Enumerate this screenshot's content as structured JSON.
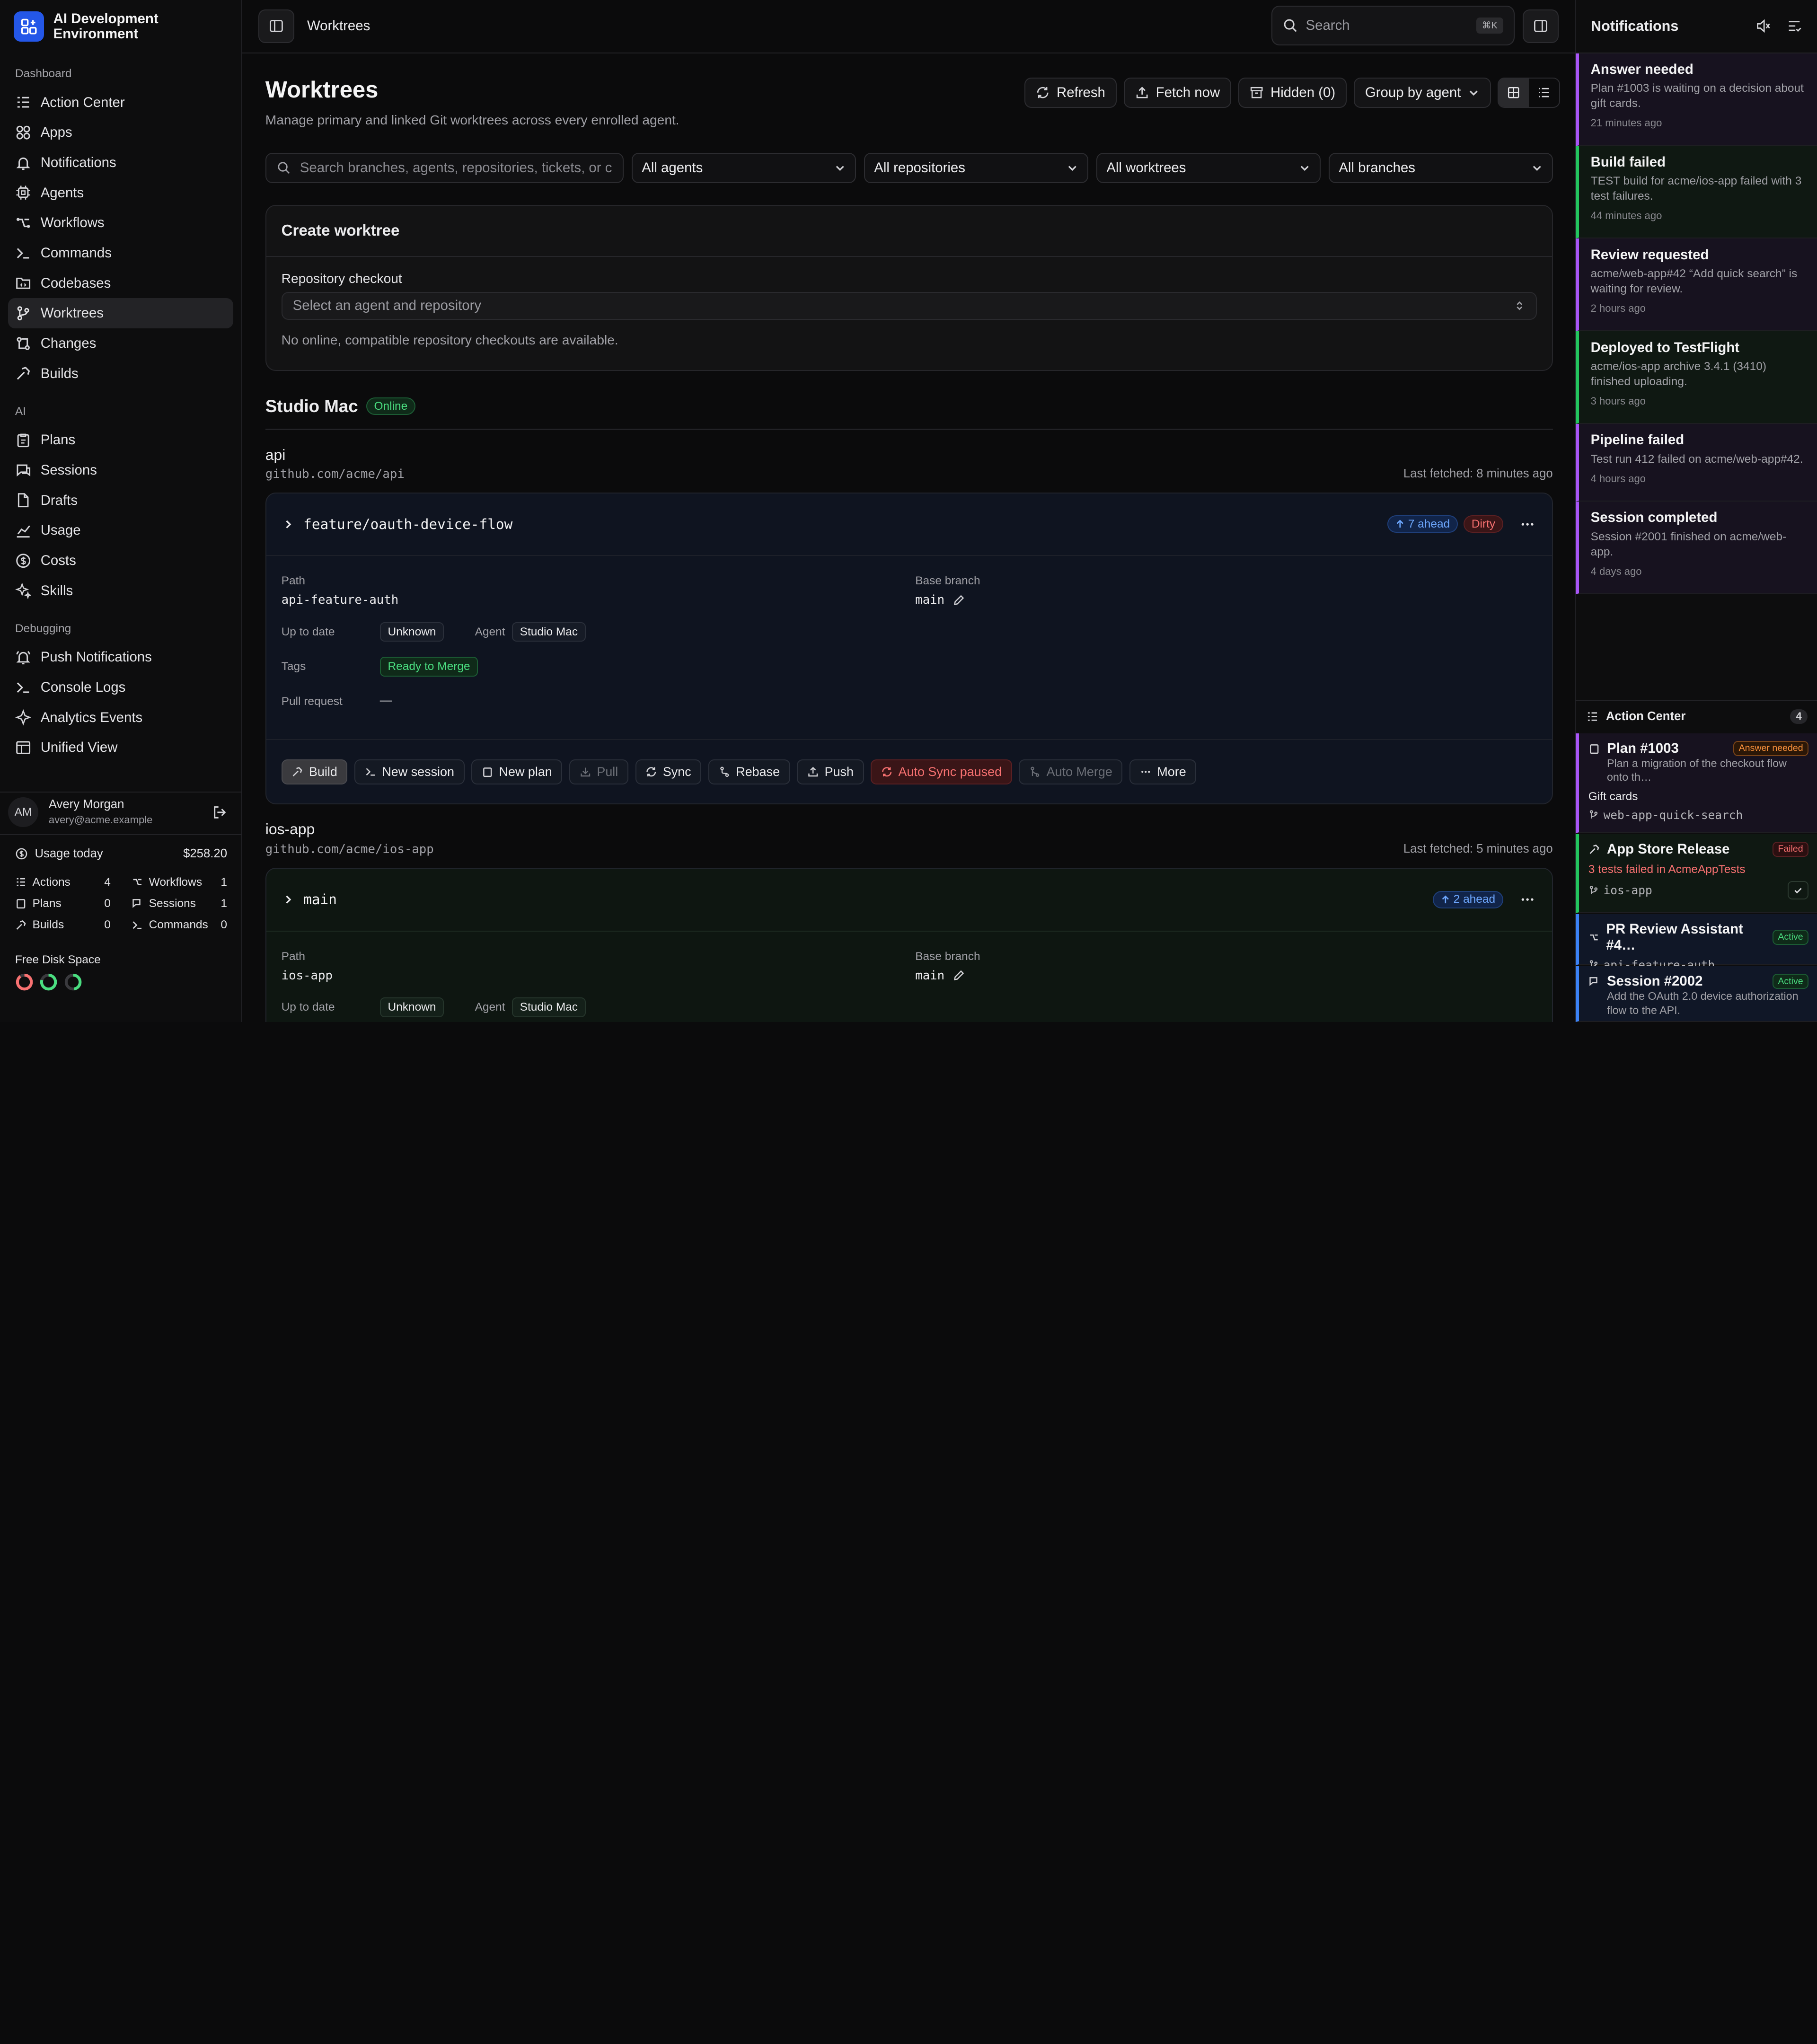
{
  "app": {
    "title_line1": "AI Development",
    "title_line2": "Environment"
  },
  "sidebar": {
    "sections": [
      {
        "label": "Dashboard",
        "items": [
          "Action Center",
          "Apps",
          "Notifications",
          "Agents",
          "Workflows",
          "Commands",
          "Codebases",
          "Worktrees",
          "Changes",
          "Builds"
        ]
      },
      {
        "label": "AI",
        "items": [
          "Plans",
          "Sessions",
          "Drafts",
          "Usage",
          "Costs",
          "Skills"
        ]
      },
      {
        "label": "Debugging",
        "items": [
          "Push Notifications",
          "Console Logs",
          "Analytics Events",
          "Unified View"
        ]
      }
    ],
    "active": "Worktrees",
    "user": {
      "initials": "AM",
      "name": "Avery Morgan",
      "email": "avery@acme.example"
    },
    "usage": {
      "label": "Usage today",
      "amount": "$258.20"
    },
    "stats": [
      {
        "label": "Actions",
        "value": "4"
      },
      {
        "label": "Workflows",
        "value": "1"
      },
      {
        "label": "Plans",
        "value": "0"
      },
      {
        "label": "Sessions",
        "value": "1"
      },
      {
        "label": "Builds",
        "value": "0"
      },
      {
        "label": "Commands",
        "value": "0"
      }
    ],
    "disk_label": "Free Disk Space",
    "disk_colors": [
      "#f87171",
      "#4ade80",
      "#4ade80"
    ]
  },
  "topbar": {
    "breadcrumb": "Worktrees",
    "search_placeholder": "Search",
    "search_shortcut": "⌘K"
  },
  "page": {
    "title": "Worktrees",
    "subtitle": "Manage primary and linked Git worktrees across every enrolled agent.",
    "toolbar": {
      "refresh": "Refresh",
      "fetch": "Fetch now",
      "hidden": "Hidden (0)",
      "group": "Group by agent"
    },
    "filters": {
      "search_placeholder": "Search branches, agents, repositories, tickets, or c",
      "agents": "All agents",
      "repos": "All repositories",
      "worktrees": "All worktrees",
      "branches": "All branches"
    },
    "create": {
      "title": "Create worktree",
      "field_label": "Repository checkout",
      "select_placeholder": "Select an agent and repository",
      "empty": "No online, compatible repository checkouts are available."
    },
    "agent": {
      "name": "Studio Mac",
      "status": "Online"
    },
    "repos": [
      {
        "name": "api",
        "url": "github.com/acme/api",
        "fetched": "Last fetched: 8 minutes ago",
        "branch": "feature/oauth-device-flow",
        "ahead": "7 ahead",
        "dirty": "Dirty",
        "labels": {
          "path": "Path",
          "base": "Base branch",
          "uptodate": "Up to date",
          "agent": "Agent",
          "tags": "Tags",
          "pr": "Pull request"
        },
        "path": "api-feature-auth",
        "base": "main",
        "uptodate": "Unknown",
        "agent": "Studio Mac",
        "tag": "Ready to Merge",
        "pr": "—",
        "actions": [
          "Build",
          "New session",
          "New plan",
          "Pull",
          "Sync",
          "Rebase",
          "Push",
          "Auto Sync paused",
          "Auto Merge",
          "More"
        ]
      },
      {
        "name": "ios-app",
        "url": "github.com/acme/ios-app",
        "fetched": "Last fetched: 5 minutes ago",
        "branch": "main",
        "ahead": "2 ahead",
        "labels": {
          "path": "Path",
          "base": "Base branch",
          "uptodate": "Up to date",
          "agent": "Agent"
        },
        "path": "ios-app",
        "base": "main",
        "uptodate": "Unknown",
        "agent": "Studio Mac"
      }
    ]
  },
  "notifications": {
    "title": "Notifications",
    "items": [
      {
        "title": "Answer needed",
        "desc": "Plan #1003 is waiting on a decision about gift cards.",
        "when": "21 minutes ago",
        "color": "#a855f7",
        "bg": "#17121f"
      },
      {
        "title": "Build failed",
        "desc": "TEST build for acme/ios-app failed with 3 test failures.",
        "when": "44 minutes ago",
        "color": "#22c55e",
        "bg": "#0f1812"
      },
      {
        "title": "Review requested",
        "desc": "acme/web-app#42 “Add quick search” is waiting for review.",
        "when": "2 hours ago",
        "color": "#a855f7",
        "bg": "#17121f"
      },
      {
        "title": "Deployed to TestFlight",
        "desc": "acme/ios-app archive 3.4.1 (3410) finished uploading.",
        "when": "3 hours ago",
        "color": "#22c55e",
        "bg": "#0f1812"
      },
      {
        "title": "Pipeline failed",
        "desc": "Test run 412 failed on acme/web-app#42.",
        "when": "4 hours ago",
        "color": "#a855f7",
        "bg": "#17121f"
      },
      {
        "title": "Session completed",
        "desc": "Session #2001 finished on acme/web-app.",
        "when": "4 days ago",
        "color": "#a855f7",
        "bg": "#17121f"
      }
    ]
  },
  "action_center": {
    "title": "Action Center",
    "count": "4",
    "items": [
      {
        "title": "Plan #1003",
        "badge": "Answer needed",
        "desc": "Plan a migration of the checkout flow onto th…",
        "extra": "Gift cards",
        "branch": "web-app-quick-search"
      },
      {
        "title": "App Store Release",
        "badge": "Failed",
        "desc": "3 tests failed in AcmeAppTests",
        "branch": "ios-app"
      },
      {
        "title": "PR Review Assistant #4…",
        "badge": "Active",
        "branch": "api-feature-auth"
      },
      {
        "title": "Session #2002",
        "badge": "Active",
        "desc": "Add the OAuth 2.0 device authorization flow to the API."
      }
    ]
  }
}
